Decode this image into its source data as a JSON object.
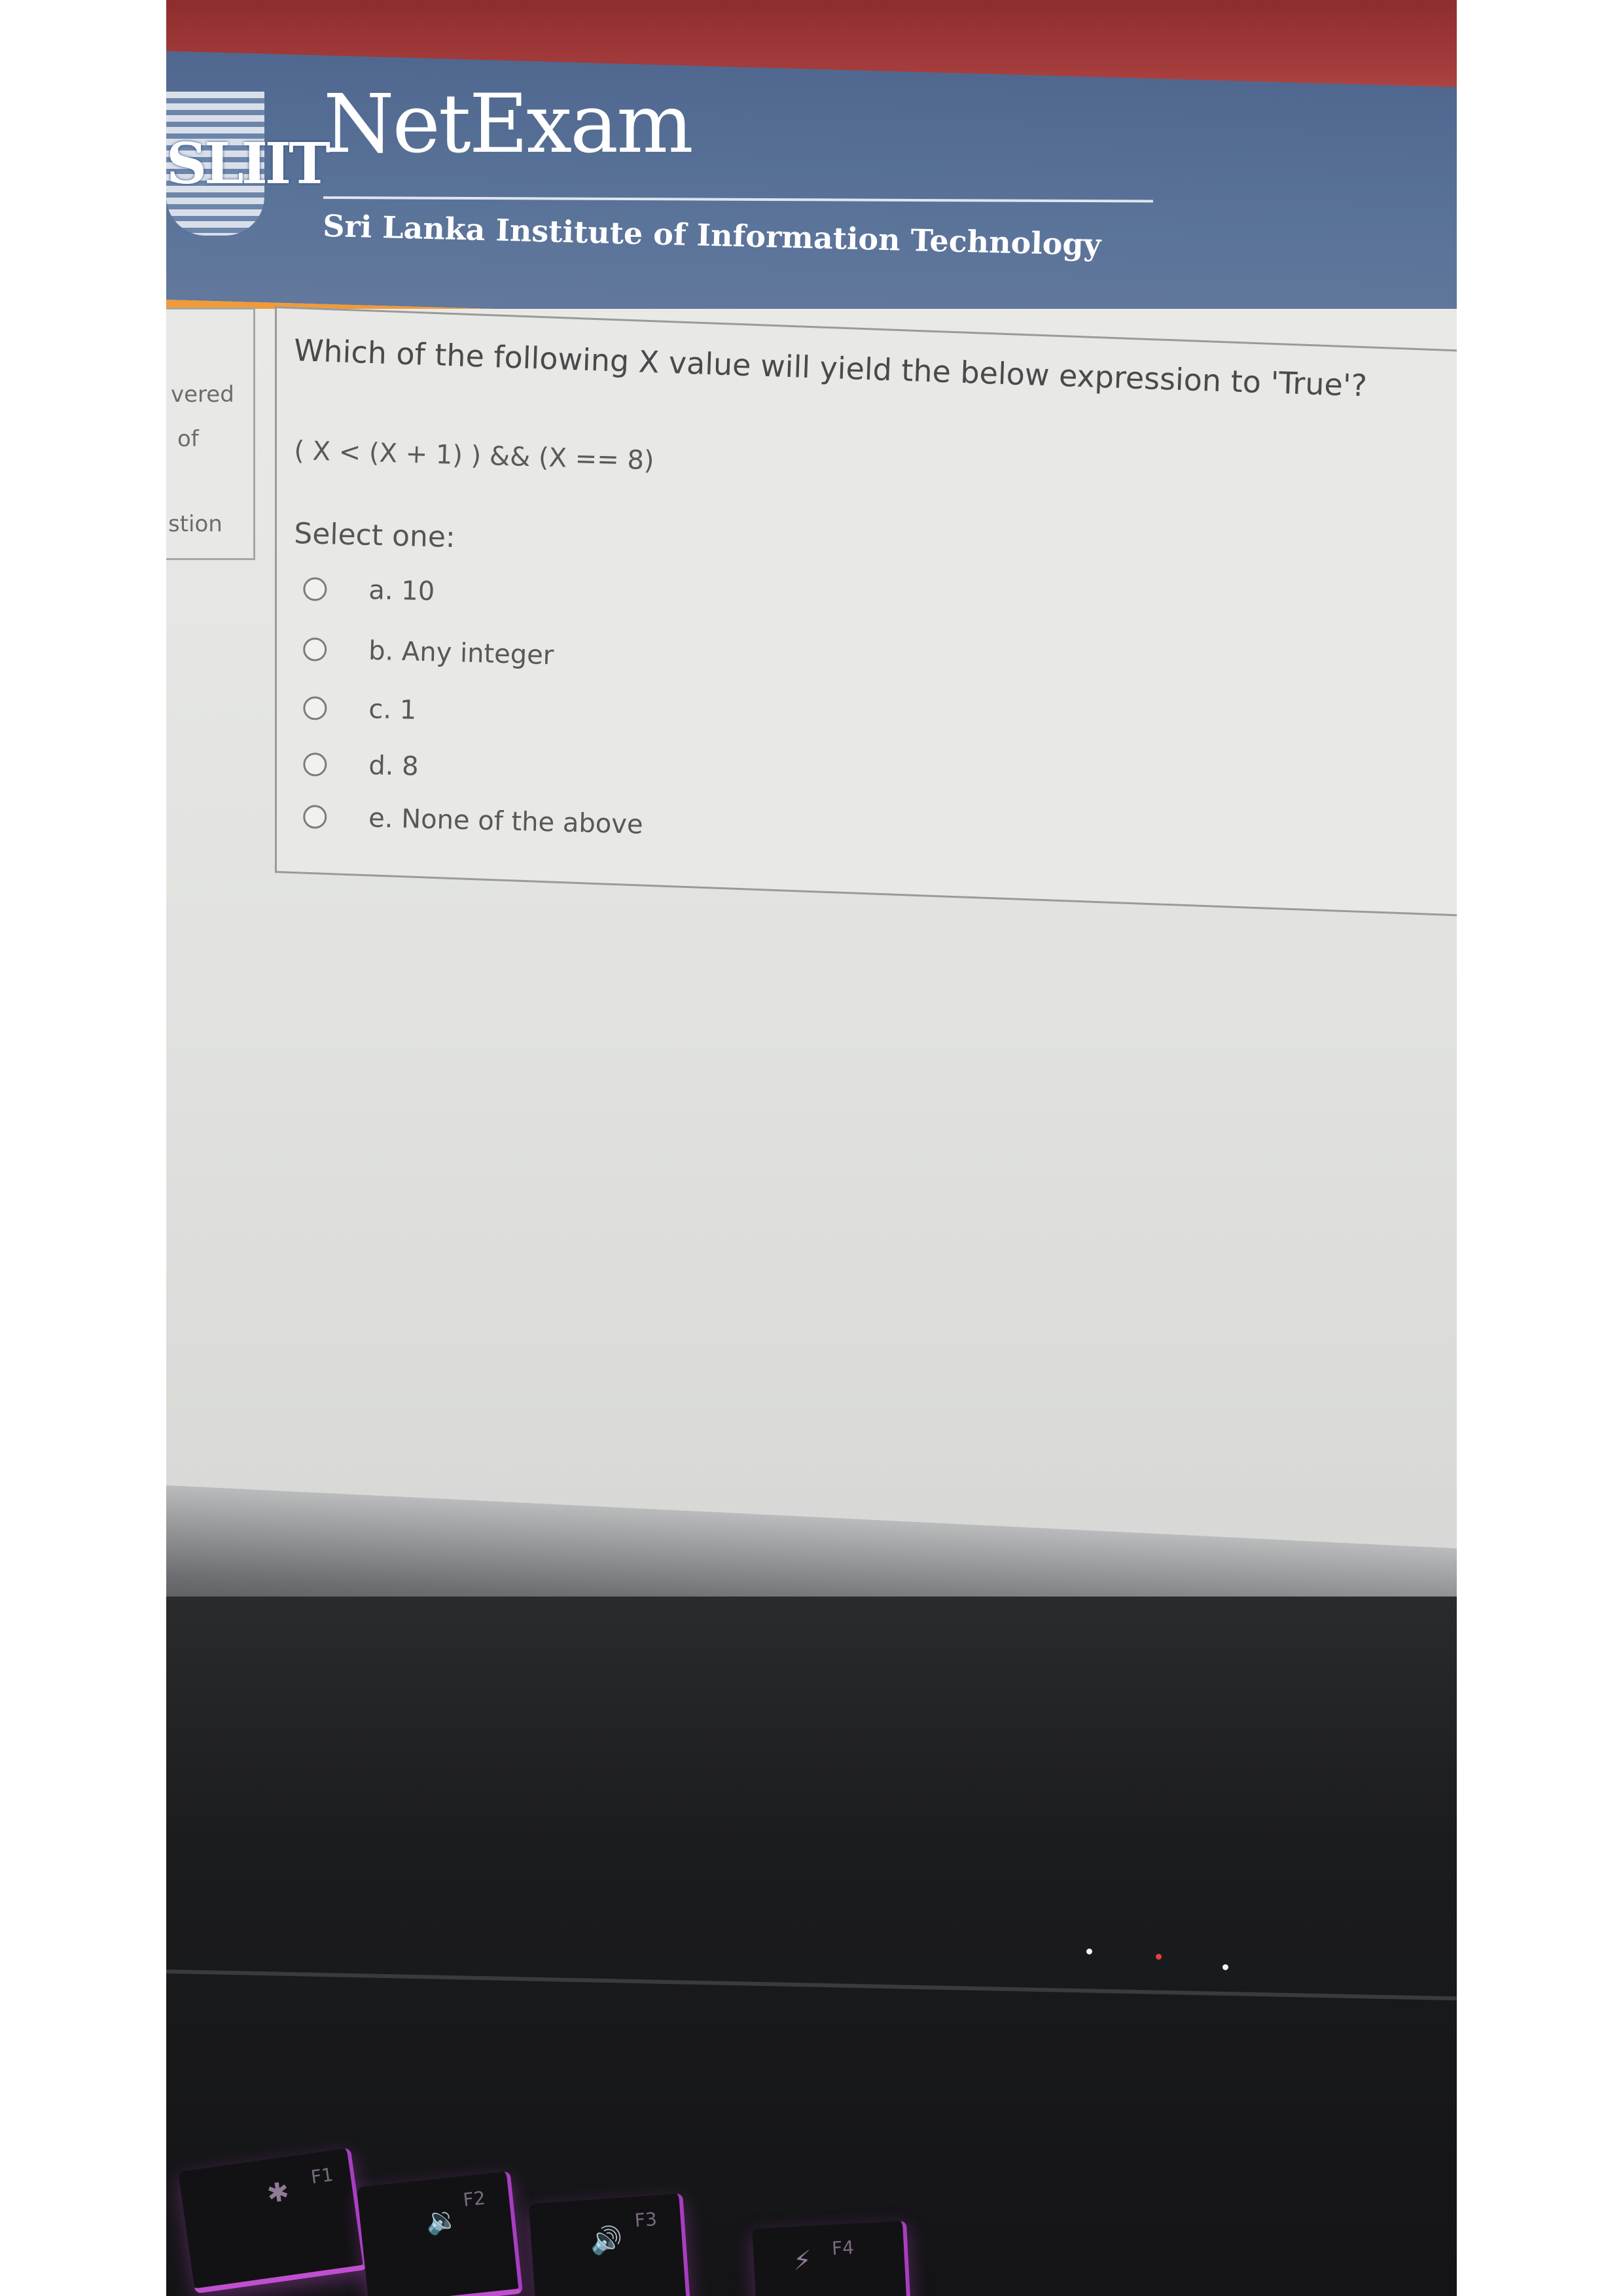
{
  "header": {
    "logo_text": "SLIIT",
    "app_title": "NetExam",
    "tagline": "Sri Lanka Institute of Information Technology"
  },
  "nav": {
    "line1": "vered",
    "line2": "of",
    "line3": "stion"
  },
  "question": {
    "text": "Which of the following X value will yield the below expression to 'True'?",
    "expression": "( X < (X + 1) ) && (X == 8)",
    "select_label": "Select one:",
    "options": [
      {
        "label": "a. 10"
      },
      {
        "label": "b. Any integer"
      },
      {
        "label": "c. 1"
      },
      {
        "label": "d. 8"
      },
      {
        "label": "e. None of the above"
      }
    ]
  },
  "keyboard": {
    "keys": [
      {
        "label": "F1",
        "icon": "✱"
      },
      {
        "label": "F2",
        "icon": "🔉"
      },
      {
        "label": "F3",
        "icon": "🔊"
      },
      {
        "label": "F4",
        "icon": "⚡"
      }
    ]
  },
  "colors": {
    "header_blue": "#5a7399",
    "top_bar_red": "#a43c3c",
    "accent_orange": "#f09a3a",
    "key_glow": "#c04fd0"
  }
}
